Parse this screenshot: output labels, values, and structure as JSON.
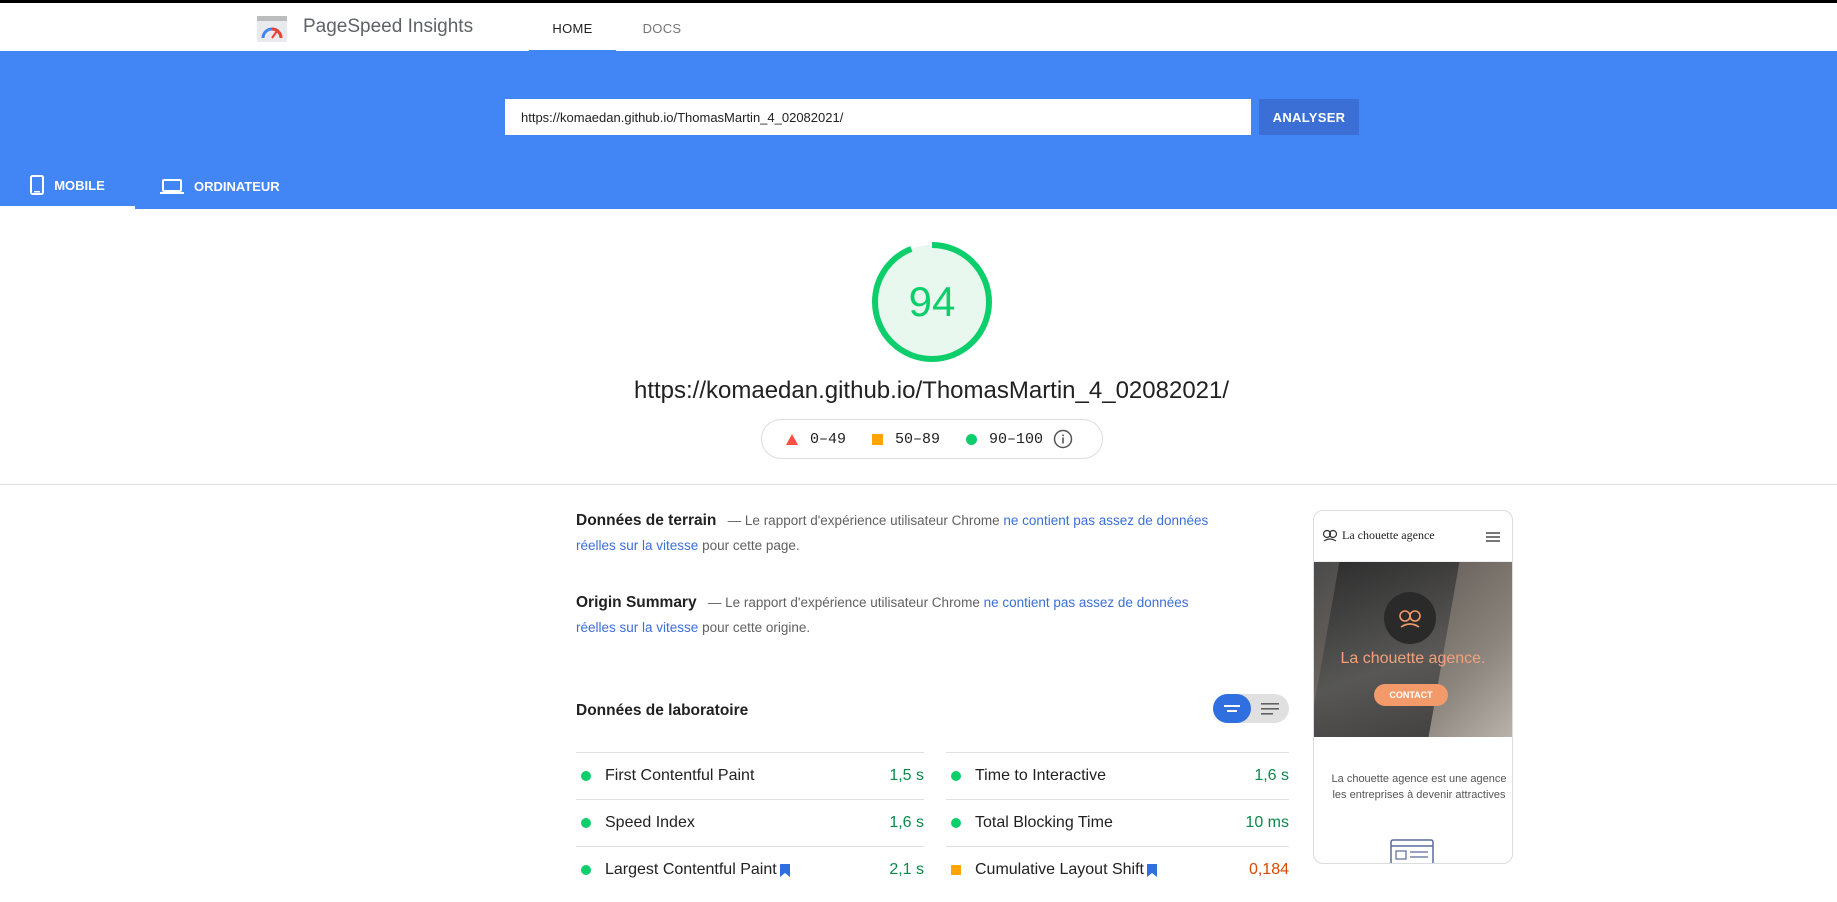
{
  "header": {
    "brand": "PageSpeed Insights",
    "nav": [
      {
        "label": "HOME",
        "active": true
      },
      {
        "label": "DOCS",
        "active": false
      }
    ]
  },
  "search": {
    "url_value": "https://komaedan.github.io/ThomasMartin_4_02082021/",
    "button_label": "ANALYSER"
  },
  "device_tabs": [
    {
      "label": "MOBILE",
      "icon": "smartphone-icon",
      "active": true
    },
    {
      "label": "ORDINATEUR",
      "icon": "laptop-icon",
      "active": false
    }
  ],
  "score": {
    "value": "94",
    "fraction": 0.94,
    "color": "#0cce6b",
    "url": "https://komaedan.github.io/ThomasMartin_4_02082021/"
  },
  "legend": [
    {
      "range": "0–49",
      "shape": "triangle",
      "color": "#ff4e42"
    },
    {
      "range": "50–89",
      "shape": "square",
      "color": "#ffa400"
    },
    {
      "range": "90–100",
      "shape": "circle",
      "color": "#0cce6b"
    }
  ],
  "field_data": {
    "title": "Données de terrain",
    "text_before": "— Le rapport d'expérience utilisateur Chrome",
    "link_line1": "ne contient pas assez de données",
    "link_line2": "réelles sur la vitesse",
    "text_after": "pour cette page."
  },
  "origin_summary": {
    "title": "Origin Summary",
    "text_before": "— Le rapport d'expérience utilisateur Chrome",
    "link_line1": "ne contient pas assez de données",
    "link_line2": "réelles sur la vitesse",
    "text_after": "pour cette origine."
  },
  "lab": {
    "title": "Données de laboratoire",
    "metrics_left": [
      {
        "name": "First Contentful Paint",
        "value": "1,5 s",
        "status": "good",
        "bookmark": false
      },
      {
        "name": "Speed Index",
        "value": "1,6 s",
        "status": "good",
        "bookmark": false
      },
      {
        "name": "Largest Contentful Paint",
        "value": "2,1 s",
        "status": "good",
        "bookmark": true
      }
    ],
    "metrics_right": [
      {
        "name": "Time to Interactive",
        "value": "1,6 s",
        "status": "good",
        "bookmark": false
      },
      {
        "name": "Total Blocking Time",
        "value": "10 ms",
        "status": "good",
        "bookmark": false
      },
      {
        "name": "Cumulative Layout Shift",
        "value": "0,184",
        "status": "average",
        "bookmark": true
      }
    ]
  },
  "preview": {
    "brand": "La chouette agence",
    "hero_title": "La chouette agence.",
    "contact": "CONTACT",
    "text_line1": "La chouette agence est une agence",
    "text_line2": "les entreprises à devenir attractives"
  }
}
